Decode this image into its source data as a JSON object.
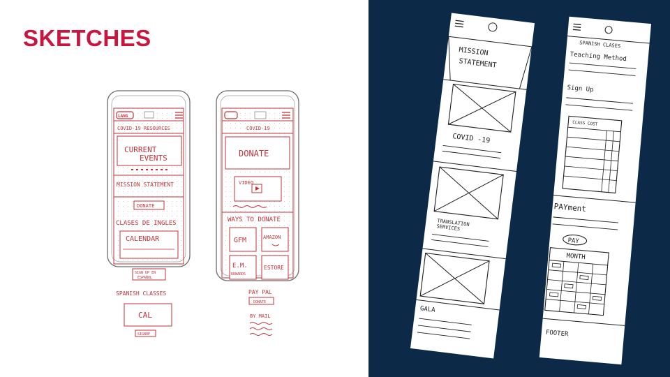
{
  "slide": {
    "title": "SKETCHES",
    "colors": {
      "accent": "#c8163f",
      "panel": "#0c2a47",
      "ink_red": "#c2323a",
      "ink_dark": "#1e1e1e"
    }
  },
  "phone1": {
    "logo": "LANG",
    "banner": "COVID-19 RESOURCES",
    "current_events": [
      "CURRENT",
      "EVENTS"
    ],
    "mission": "MISSION STATEMENT",
    "donate": "DONATE",
    "classes": "CLASES DE INGLES",
    "calendar": "CALENDAR",
    "signup": [
      "SIGN UP EN",
      "ESPAÑOL"
    ],
    "spanish_classes": "SPANISH CLASSES",
    "cal": "CAL",
    "signup_small": "SIGNUP"
  },
  "phone2": {
    "banner": "COVID-19",
    "donate": "DONATE",
    "video": "VIDEO",
    "ways": "WAYS TO DONATE",
    "gfm": "GFM",
    "amazon": "AMAZON",
    "em": [
      "E.M.",
      "REWARDS"
    ],
    "estore": "ESTORE",
    "paypal": "PAY PAL",
    "paypal_btn": "DONATE",
    "bymail": "BY MAIL"
  },
  "strip1": {
    "mission": [
      "MISSION",
      "STATEMENT"
    ],
    "covid": "COVID -19",
    "translation": [
      "TRANSLATION",
      "SERVICES"
    ],
    "gala": "GALA"
  },
  "strip2": {
    "spanish": "SPANISH CLASES",
    "teaching": "Teaching Method",
    "signup": "Sign Up",
    "cost": "CLASS COST",
    "payment": "PAYment",
    "pay": "PAY",
    "month": "MONTH",
    "footer": "FOOTER"
  }
}
